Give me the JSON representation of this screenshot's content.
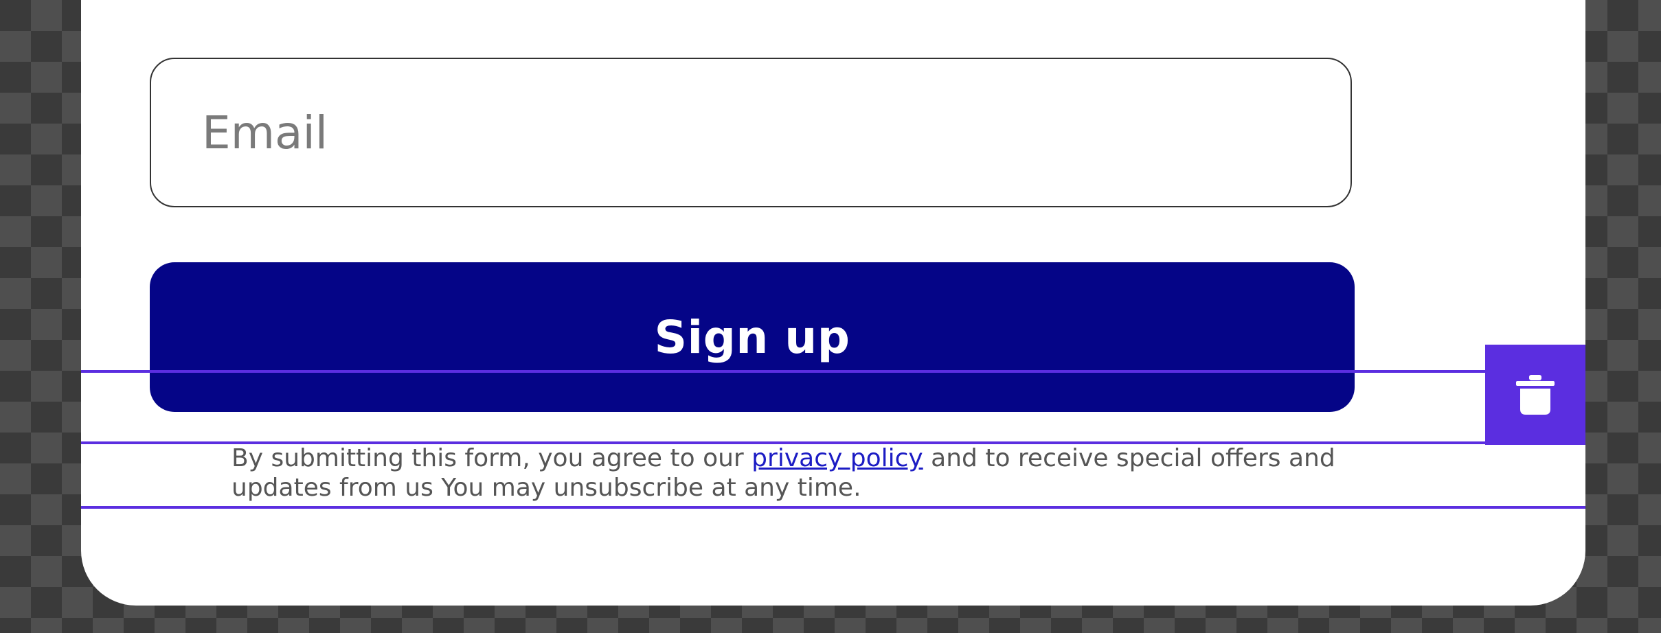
{
  "form": {
    "email_placeholder": "Email",
    "signup_label": "Sign up"
  },
  "disclaimer": {
    "before_link": "By submitting this form, you agree to our ",
    "link_text": "privacy policy",
    "after_link_line1": " and to receive special offers and",
    "line2": "updates from us You may unsubscribe at any time."
  },
  "icons": {
    "delete": "trash-icon"
  },
  "colors": {
    "button_bg": "#050587",
    "selection_accent": "#5b2ee0",
    "link": "#1c1cc4",
    "text_muted": "#555555",
    "placeholder": "#7a7a7a",
    "card_bg": "#ffffff"
  }
}
